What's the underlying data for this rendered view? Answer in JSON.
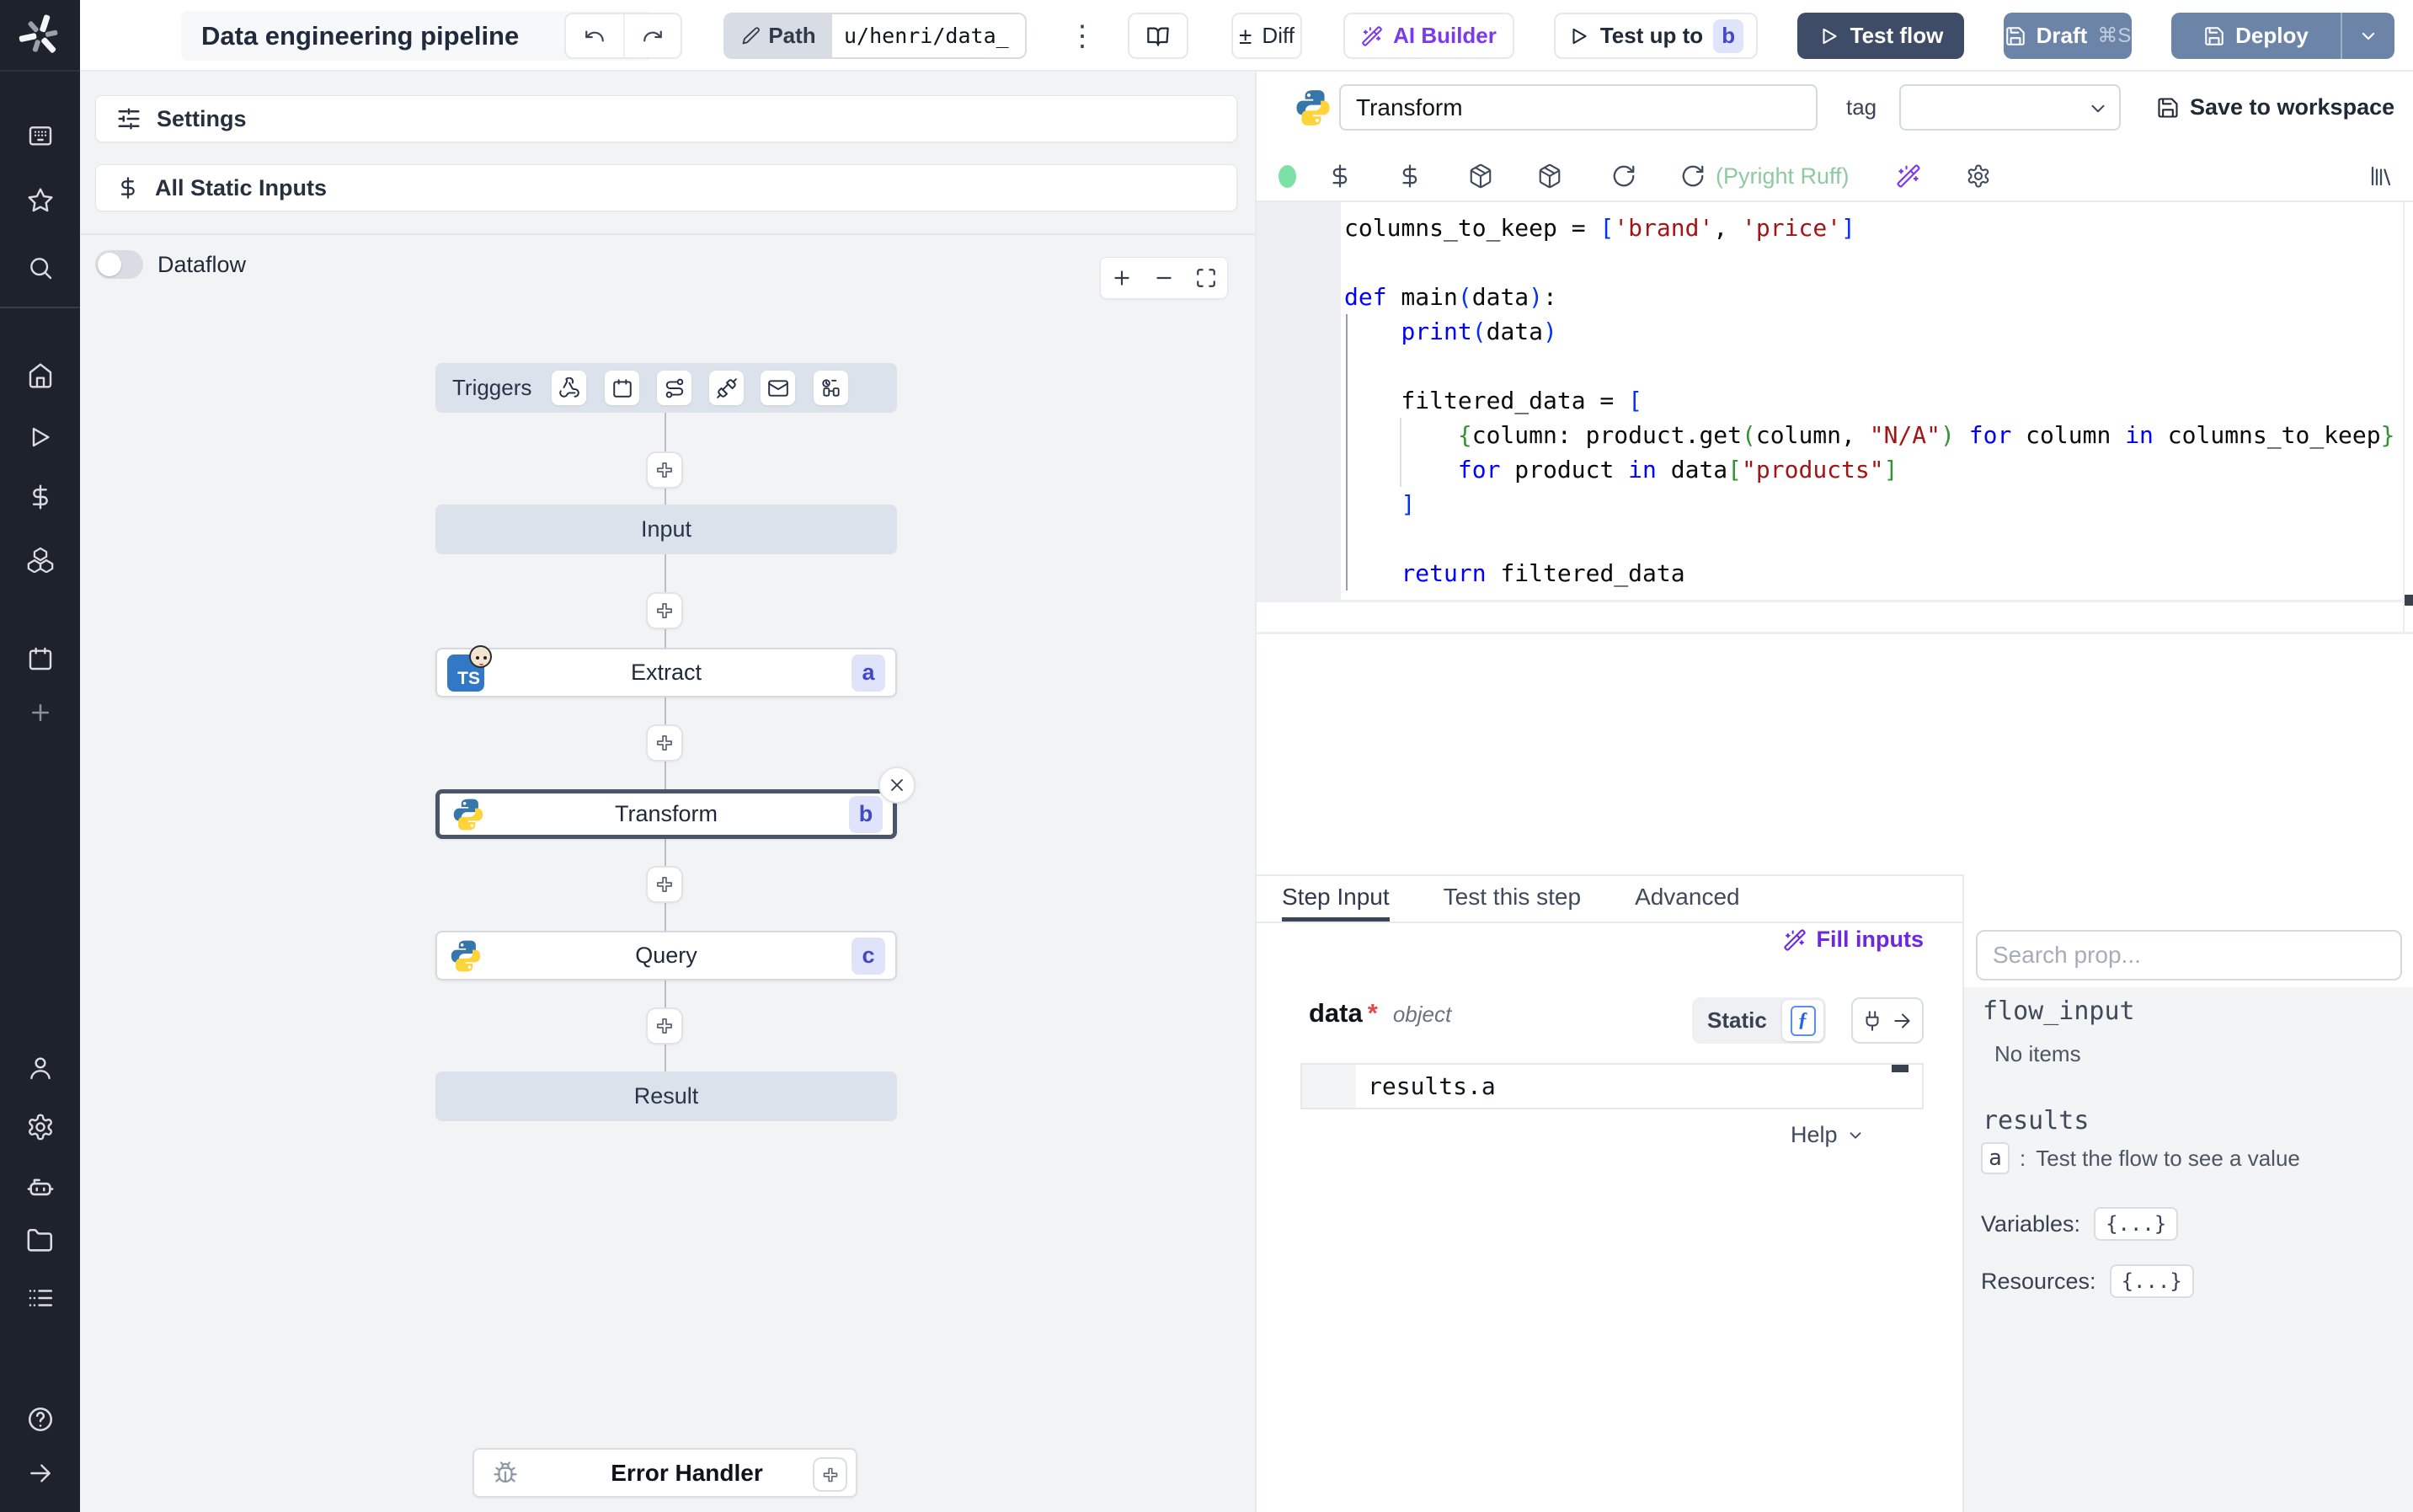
{
  "colors": {
    "accent_indigo": "#4348c6",
    "badge_bg": "#e0e4fb",
    "purple": "#7c3aed",
    "dark_button": "#3e4c68",
    "slate_button": "#6b84a8",
    "node_fill": "#dbe2eb",
    "selected_border": "#4a5568",
    "status_green": "#7de0a5",
    "lint_green": "#8fc9a1",
    "code_keyword": "#0000ff",
    "code_string": "#a31515",
    "code_bracket_depth1": "#0431fa",
    "code_bracket_depth2": "#319331"
  },
  "topbar": {
    "title": "Data engineering pipeline",
    "path_label": "Path",
    "path_value": "u/henri/data_",
    "diff_glyph": "±",
    "diff_label": "Diff",
    "ai_builder_label": "AI Builder",
    "test_up_to_label": "Test up to",
    "test_up_to_badge": "b",
    "test_flow_label": "Test flow",
    "draft_label": "Draft",
    "draft_shortcut": "⌘S",
    "deploy_label": "Deploy",
    "kebab_glyph": "⋮"
  },
  "flow_panel": {
    "settings_label": "Settings",
    "static_inputs_label": "All Static Inputs",
    "dataflow_label": "Dataflow"
  },
  "flow": {
    "triggers_label": "Triggers",
    "input_label": "Input",
    "result_label": "Result",
    "error_handler_label": "Error Handler",
    "steps": [
      {
        "label": "Extract",
        "badge": "a",
        "lang": "bun"
      },
      {
        "label": "Transform",
        "badge": "b",
        "lang": "python"
      },
      {
        "label": "Query",
        "badge": "c",
        "lang": "python"
      }
    ],
    "close_glyph": "×"
  },
  "editor": {
    "step_name": "Transform",
    "tag_label": "tag",
    "save_label": "Save to workspace",
    "lint_label": "(Pyright Ruff)",
    "code_lines": [
      [
        {
          "t": "columns_to_keep = ",
          "c": "p"
        },
        {
          "t": "[",
          "c": "b1"
        },
        {
          "t": "'brand'",
          "c": "s"
        },
        {
          "t": ", ",
          "c": "p"
        },
        {
          "t": "'price'",
          "c": "s"
        },
        {
          "t": "]",
          "c": "b1"
        }
      ],
      [],
      [
        {
          "t": "def",
          "c": "k"
        },
        {
          "t": " main",
          "c": "p"
        },
        {
          "t": "(",
          "c": "b1"
        },
        {
          "t": "data",
          "c": "p"
        },
        {
          "t": ")",
          "c": "b1"
        },
        {
          "t": ":",
          "c": "p"
        }
      ],
      [
        {
          "t": "    ",
          "c": "p"
        },
        {
          "t": "print",
          "c": "k"
        },
        {
          "t": "(",
          "c": "b1"
        },
        {
          "t": "data",
          "c": "p"
        },
        {
          "t": ")",
          "c": "b1"
        }
      ],
      [],
      [
        {
          "t": "    filtered_data = ",
          "c": "p"
        },
        {
          "t": "[",
          "c": "b1"
        }
      ],
      [
        {
          "t": "        ",
          "c": "p"
        },
        {
          "t": "{",
          "c": "b2"
        },
        {
          "t": "column: product.get",
          "c": "p"
        },
        {
          "t": "(",
          "c": "b2"
        },
        {
          "t": "column, ",
          "c": "p"
        },
        {
          "t": "\"N/A\"",
          "c": "s"
        },
        {
          "t": ")",
          "c": "b2"
        },
        {
          "t": " ",
          "c": "p"
        },
        {
          "t": "for",
          "c": "k"
        },
        {
          "t": " column ",
          "c": "p"
        },
        {
          "t": "in",
          "c": "k"
        },
        {
          "t": " columns_to_keep",
          "c": "p"
        },
        {
          "t": "}",
          "c": "b2"
        }
      ],
      [
        {
          "t": "        ",
          "c": "p"
        },
        {
          "t": "for",
          "c": "k"
        },
        {
          "t": " product ",
          "c": "p"
        },
        {
          "t": "in",
          "c": "k"
        },
        {
          "t": " data",
          "c": "p"
        },
        {
          "t": "[",
          "c": "b2"
        },
        {
          "t": "\"products\"",
          "c": "s"
        },
        {
          "t": "]",
          "c": "b2"
        }
      ],
      [
        {
          "t": "    ",
          "c": "p"
        },
        {
          "t": "]",
          "c": "b1"
        }
      ],
      [],
      [
        {
          "t": "    ",
          "c": "p"
        },
        {
          "t": "return",
          "c": "k"
        },
        {
          "t": " filtered_data",
          "c": "p"
        }
      ]
    ]
  },
  "step_panel": {
    "tabs": [
      {
        "label": "Step Input"
      },
      {
        "label": "Test this step"
      },
      {
        "label": "Advanced"
      }
    ],
    "fill_inputs_label": "Fill inputs",
    "arg_name": "data",
    "arg_required_mark": "*",
    "arg_type": "object",
    "static_label": "Static",
    "fn_glyph": "ƒ",
    "expr_value": "results.a",
    "help_label": "Help"
  },
  "props_panel": {
    "search_placeholder": "Search prop...",
    "flow_input_label": "flow_input",
    "flow_input_empty": "No items",
    "results_label": "results",
    "result_items": [
      {
        "key": "a",
        "separator": ":",
        "hint": "Test the flow to see a value"
      }
    ],
    "variables_label": "Variables:",
    "variables_value": "{...}",
    "resources_label": "Resources:",
    "resources_value": "{...}"
  }
}
